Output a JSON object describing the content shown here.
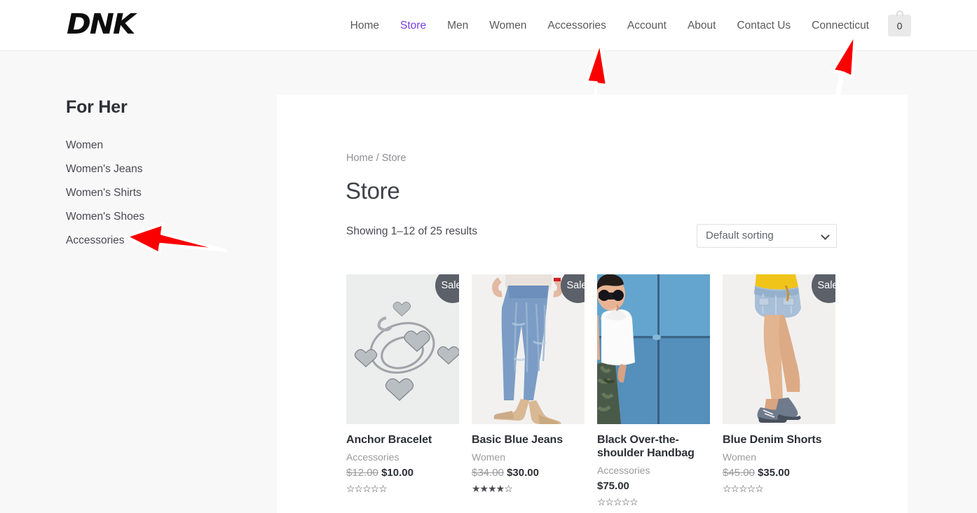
{
  "header": {
    "logo_text": "DNK",
    "nav_items": [
      {
        "label": "Home",
        "active": false
      },
      {
        "label": "Store",
        "active": true
      },
      {
        "label": "Men",
        "active": false
      },
      {
        "label": "Women",
        "active": false
      },
      {
        "label": "Accessories",
        "active": false
      },
      {
        "label": "Account",
        "active": false
      },
      {
        "label": "About",
        "active": false
      },
      {
        "label": "Contact Us",
        "active": false
      },
      {
        "label": "Connecticut",
        "active": false
      }
    ],
    "cart": {
      "icon": "shopping-bag-icon",
      "count": "0"
    },
    "active_color": "#7b3fe4"
  },
  "sidebar": {
    "title": "For Her",
    "items": [
      {
        "label": "Women"
      },
      {
        "label": "Women's Jeans"
      },
      {
        "label": "Women's Shirts"
      },
      {
        "label": "Women's Shoes"
      },
      {
        "label": "Accessories"
      }
    ]
  },
  "main": {
    "breadcrumb": "Home / Store",
    "page_title": "Store",
    "result_count": "Showing 1–12 of 25 results",
    "sorting": {
      "selected": "Default sorting",
      "icon": "chevron-down-icon",
      "options": [
        "Default sorting"
      ]
    },
    "sale_badge_label": "Sale!",
    "sale_badge_color": "#5c6068",
    "products": [
      {
        "name": "Anchor Bracelet",
        "category": "Accessories",
        "price_old": "$12.00",
        "price_new": "$10.00",
        "on_sale": true,
        "rating": 0,
        "stars": "☆☆☆☆☆",
        "image": "silver-heart-charm-bracelet"
      },
      {
        "name": "Basic Blue Jeans",
        "category": "Women",
        "price_old": "$34.00",
        "price_new": "$30.00",
        "on_sale": true,
        "rating": 4,
        "stars": "★★★★☆",
        "image": "woman-wearing-blue-jeans-and-heels"
      },
      {
        "name": "Black Over-the-shoulder Handbag",
        "category": "Accessories",
        "price_old": "",
        "price_new": "$75.00",
        "on_sale": false,
        "rating": 0,
        "stars": "☆☆☆☆☆",
        "image": "man-in-white-tshirt-against-blue-wall"
      },
      {
        "name": "Blue Denim Shorts",
        "category": "Women",
        "price_old": "$45.00",
        "price_new": "$35.00",
        "on_sale": true,
        "rating": 0,
        "stars": "☆☆☆☆☆",
        "image": "woman-wearing-denim-shorts-and-sneakers"
      }
    ]
  },
  "annotations": {
    "color": "#fa0000",
    "arrows": [
      {
        "name": "arrow-pointing-to-accessories-nav",
        "target": "Accessories"
      },
      {
        "name": "arrow-pointing-to-connecticut-nav",
        "target": "Connecticut"
      },
      {
        "name": "arrow-pointing-to-sidebar-accessories",
        "target": "Accessories"
      }
    ]
  }
}
